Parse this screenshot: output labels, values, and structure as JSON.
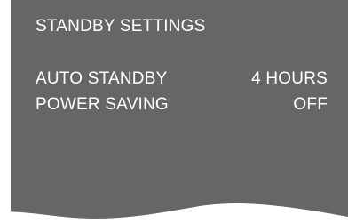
{
  "menu": {
    "title": "STANDBY SETTINGS",
    "items": [
      {
        "label": "AUTO STANDBY",
        "value": "4 HOURS"
      },
      {
        "label": "POWER SAVING",
        "value": "OFF"
      }
    ]
  },
  "colors": {
    "panel_background": "#666666",
    "text": "#ffffff",
    "page_background": "#ffffff"
  }
}
